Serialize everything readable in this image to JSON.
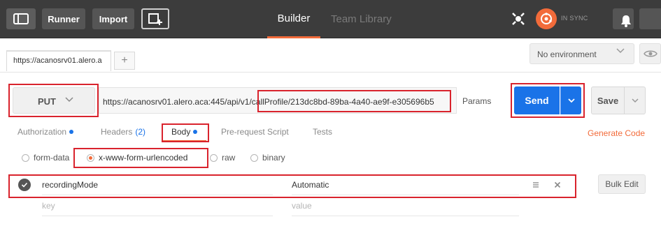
{
  "toolbar": {
    "runner_label": "Runner",
    "import_label": "Import",
    "tabs": [
      {
        "label": "Builder",
        "active": true
      },
      {
        "label": "Team Library",
        "active": false
      }
    ],
    "sync_status": "IN SYNC"
  },
  "tabstrip": {
    "request_tab_label": "https://acanosrv01.alero.a",
    "add_tab_symbol": "+",
    "environment": "No environment"
  },
  "request": {
    "method": "PUT",
    "url": "https://acanosrv01.alero.aca:445/api/v1/callProfile/213dc8bd-89ba-4a40-ae9f-e305696b5",
    "params_label": "Params",
    "send_label": "Send",
    "save_label": "Save"
  },
  "subtabs": {
    "authorization": "Authorization",
    "headers": "Headers",
    "headers_count": "(2)",
    "body": "Body",
    "pre_request": "Pre-request Script",
    "tests": "Tests",
    "generate_code": "Generate Code"
  },
  "body_types": [
    {
      "label": "form-data",
      "selected": false
    },
    {
      "label": "x-www-form-urlencoded",
      "selected": true
    },
    {
      "label": "raw",
      "selected": false
    },
    {
      "label": "binary",
      "selected": false
    }
  ],
  "params": {
    "rows": [
      {
        "key": "recordingMode",
        "value": "Automatic",
        "enabled": true
      }
    ],
    "new_row": {
      "key_placeholder": "key",
      "value_placeholder": "value"
    },
    "bulk_edit_label": "Bulk Edit"
  },
  "colors": {
    "accent_orange": "#f26b3a",
    "send_blue": "#1a73e8",
    "highlight_red": "#d9232d",
    "topbar": "#3c3c3c"
  }
}
